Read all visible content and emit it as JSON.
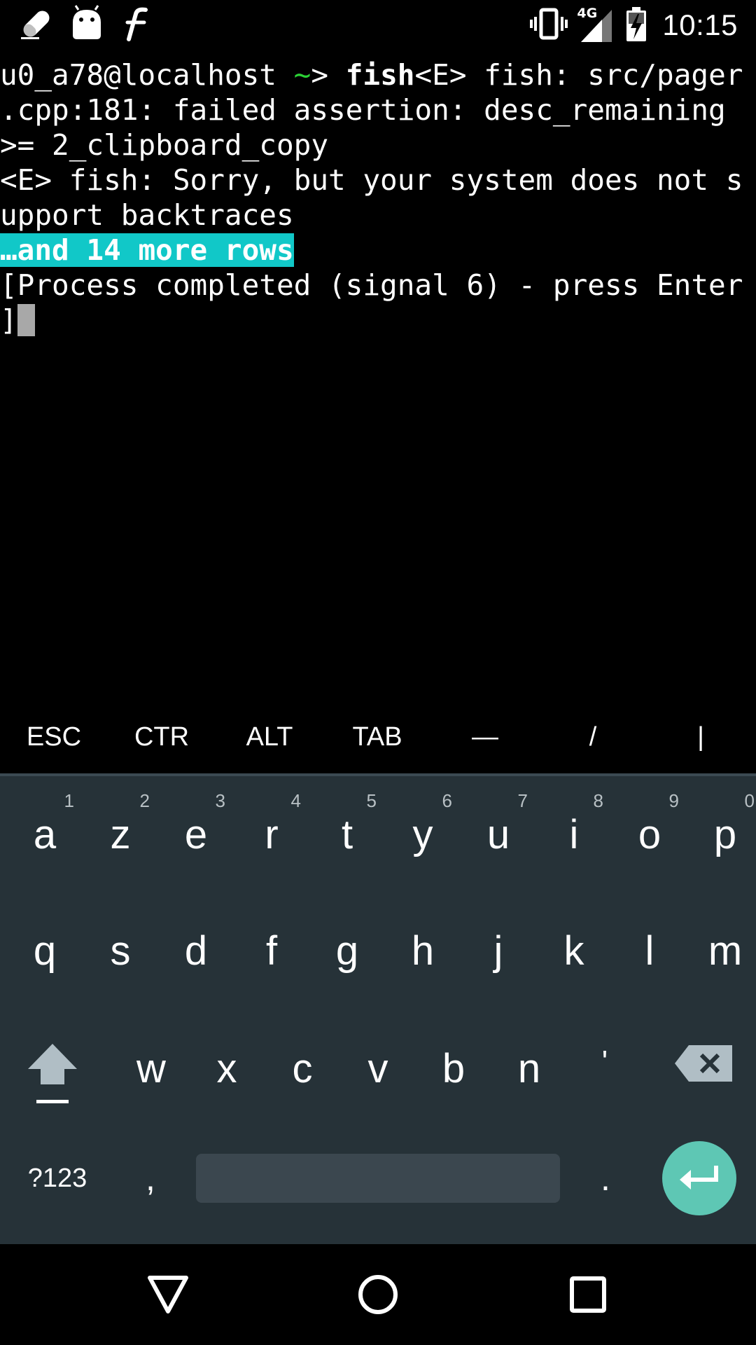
{
  "status_bar": {
    "time": "10:15",
    "network": "4G",
    "left_icons": [
      "eraser-icon",
      "android-icon",
      "font-icon"
    ],
    "right_icons": [
      "vibrate-icon",
      "signal-4g-icon",
      "battery-charging-icon"
    ]
  },
  "terminal": {
    "prompt_user": "u0_a78@localhost",
    "prompt_tilde": "~",
    "prompt_gt": ">",
    "command": "fish",
    "line1_rest": "<E> fish: src/pager",
    "line2": ".cpp:181: failed assertion: desc_remaining",
    "line3": ">= 2_clipboard_copy",
    "line4": "<E> fish: Sorry, but your system does not s",
    "line5": "upport backtraces",
    "highlight": "…and 14 more rows",
    "line7": "[Process completed (signal 6) - press Enter",
    "line8": "]"
  },
  "extra_keys": [
    "ESC",
    "CTR",
    "ALT",
    "TAB",
    "—",
    "/",
    "|"
  ],
  "keyboard": {
    "row1": [
      {
        "letter": "a",
        "hint": "1"
      },
      {
        "letter": "z",
        "hint": "2"
      },
      {
        "letter": "e",
        "hint": "3"
      },
      {
        "letter": "r",
        "hint": "4"
      },
      {
        "letter": "t",
        "hint": "5"
      },
      {
        "letter": "y",
        "hint": "6"
      },
      {
        "letter": "u",
        "hint": "7"
      },
      {
        "letter": "i",
        "hint": "8"
      },
      {
        "letter": "o",
        "hint": "9"
      },
      {
        "letter": "p",
        "hint": "0"
      }
    ],
    "row2": [
      "q",
      "s",
      "d",
      "f",
      "g",
      "h",
      "j",
      "k",
      "l",
      "m"
    ],
    "row3": [
      "w",
      "x",
      "c",
      "v",
      "b",
      "n",
      "'"
    ],
    "symbols_label": "?123",
    "comma": ",",
    "period": ".",
    "colors": {
      "background": "#263238",
      "enter": "#5ec7b4",
      "highlight": "#11c8c8"
    }
  }
}
